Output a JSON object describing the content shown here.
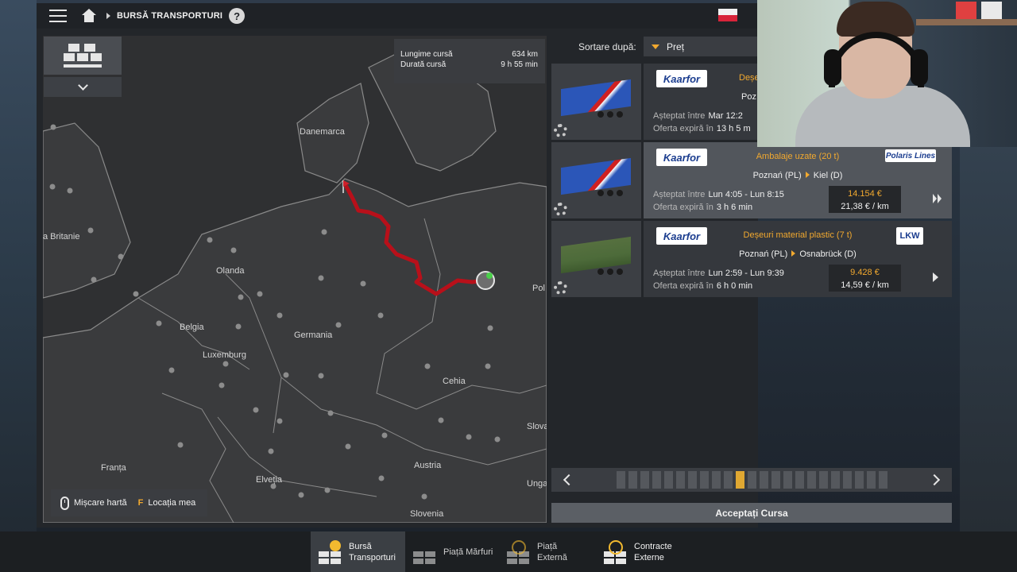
{
  "topbar": {
    "breadcrumb": "BURSĂ TRANSPORTURI",
    "help_label": "?"
  },
  "map": {
    "route_info": {
      "length_label": "Lungime cursă",
      "length_value": "634 km",
      "duration_label": "Durată cursă",
      "duration_value": "9 h 55 min"
    },
    "labels": [
      "Danemarca",
      "a Britanie",
      "Olanda",
      "Belgia",
      "Germania",
      "Luxemburg",
      "Cehia",
      "Franța",
      "Austria",
      "Elveția",
      "Slovenia",
      "Pol",
      "Slova",
      "Unga"
    ],
    "legend": {
      "move_map": "Mișcare hartă",
      "key": "F",
      "my_location": "Locația mea"
    }
  },
  "sort": {
    "label": "Sortare după:",
    "value": "Preț"
  },
  "offers": [
    {
      "company": "Kaarfor",
      "cargo": "Deșe",
      "route_from": "Poz",
      "route_to": "",
      "expected_label": "Așteptat între",
      "expected_value": "Mar 12:2",
      "expires_label": "Oferta expiră în",
      "expires_value": "13 h 5 m",
      "price_total": "",
      "price_per_km": "",
      "client": "",
      "trailer_color": "#2b56b8"
    },
    {
      "company": "Kaarfor",
      "cargo": "Ambalaje uzate (20 t)",
      "route_from": "Poznań (PL)",
      "route_to": "Kiel (D)",
      "expected_label": "Așteptat între",
      "expected_value": "Lun 4:05 - Lun 8:15",
      "expires_label": "Oferta expiră în",
      "expires_value": "3 h 6 min",
      "price_total": "14.154 €",
      "price_per_km": "21,38 € / km",
      "client": "Polaris Lines",
      "trailer_color": "#2b56b8"
    },
    {
      "company": "Kaarfor",
      "cargo": "Deșeuri material plastic (7 t)",
      "route_from": "Poznań (PL)",
      "route_to": "Osnabrück (D)",
      "expected_label": "Așteptat între",
      "expected_value": "Lun 2:59 - Lun 9:39",
      "expires_label": "Oferta expiră în",
      "expires_value": "6 h 0 min",
      "price_total": "9.428 €",
      "price_per_km": "14,59 € / km",
      "client": "LKW",
      "trailer_color": "#4d6b3a"
    }
  ],
  "pager": {
    "current_page": 11,
    "page_count": 23
  },
  "accept_button": "Acceptați Cursa",
  "tabs": [
    {
      "line1": "Bursă",
      "line2": "Transporturi"
    },
    {
      "line1": "Piață Mărfuri",
      "line2": ""
    },
    {
      "line1": "Piață",
      "line2": "Externă"
    },
    {
      "line1": "Contracte",
      "line2": "Externe"
    }
  ],
  "colors": {
    "accent": "#f2a92f",
    "route": "#c0101a",
    "panel": "#23262a"
  }
}
